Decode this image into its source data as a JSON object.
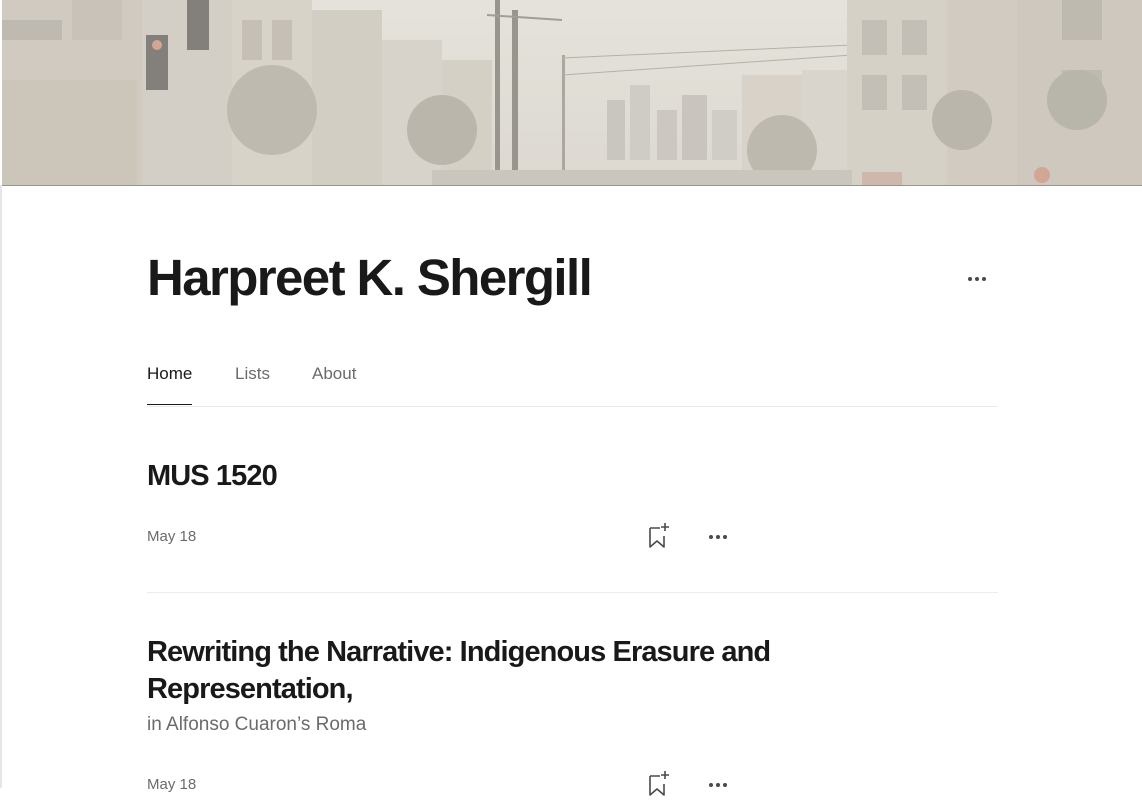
{
  "profile": {
    "name": "Harpreet K. Shergill"
  },
  "icons": {
    "more": "more-horizontal-icon",
    "bookmark": "bookmark-add-icon"
  },
  "tabs": [
    {
      "label": "Home",
      "active": true
    },
    {
      "label": "Lists",
      "active": false
    },
    {
      "label": "About",
      "active": false
    }
  ],
  "posts": [
    {
      "title": "MUS 1520",
      "subtitle": "",
      "date": "May 18"
    },
    {
      "title": "Rewriting the Narrative: Indigenous Erasure and Representation,",
      "subtitle": "in Alfonso Cuaron’s Roma",
      "date": "May 18"
    }
  ],
  "colors": {
    "text_primary": "#191919",
    "text_secondary": "#6b6b6b",
    "divider": "#ececec"
  }
}
